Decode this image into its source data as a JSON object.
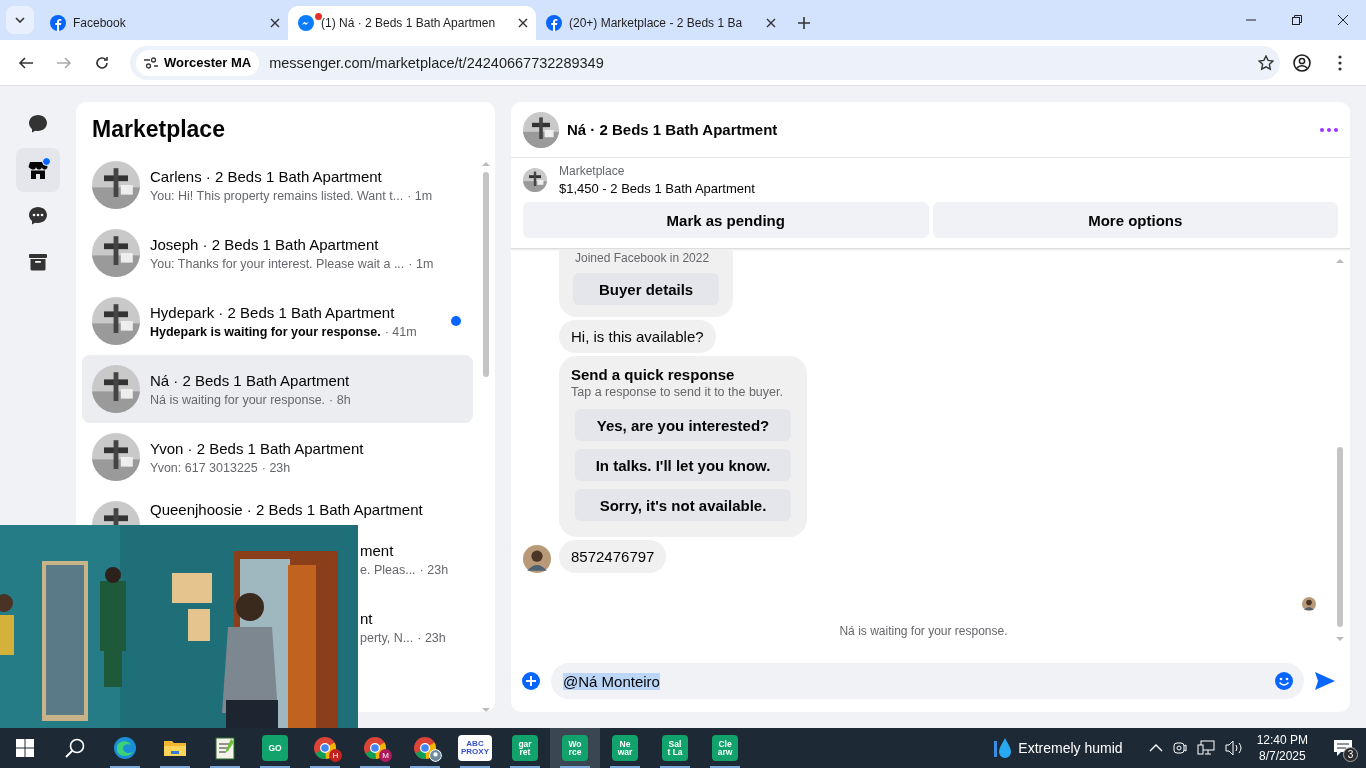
{
  "browser": {
    "tabs": [
      {
        "title": "Facebook",
        "kind": "facebook",
        "selected": false,
        "notification": false
      },
      {
        "title": "(1) Ná · 2 Beds 1 Bath Apartmen",
        "kind": "messenger",
        "selected": true,
        "notification": true
      },
      {
        "title": "(20+) Marketplace - 2 Beds 1 Ba",
        "kind": "facebook",
        "selected": false,
        "notification": false
      }
    ],
    "site_chip": "Worcester MA",
    "url": "messenger.com/marketplace/t/24240667732289349"
  },
  "nav": [
    {
      "kind": "chats",
      "selected": false,
      "unread": false
    },
    {
      "kind": "marketplace",
      "selected": true,
      "unread": true
    },
    {
      "kind": "requests",
      "selected": false,
      "unread": false
    },
    {
      "kind": "archive",
      "selected": false,
      "unread": false
    }
  ],
  "list": {
    "title": "Marketplace",
    "rows": [
      {
        "kind": "full",
        "title": "Carlens · 2 Beds 1 Bath Apartment",
        "preview": "You: Hi! This property remains listed. Want t...",
        "time": "· 1m",
        "unread": false,
        "selected": false
      },
      {
        "kind": "full",
        "title": "Joseph · 2 Beds 1 Bath Apartment",
        "preview": "You: Thanks for your interest. Please wait a ...",
        "time": "· 1m",
        "unread": false,
        "selected": false
      },
      {
        "kind": "full",
        "title": "Hydepark · 2 Beds 1 Bath Apartment",
        "preview": "Hydepark is waiting for your response.",
        "time": "· 41m",
        "unread": true,
        "selected": false
      },
      {
        "kind": "full",
        "title": "Ná · 2 Beds 1 Bath Apartment",
        "preview": "Ná is waiting for your response.",
        "time": "· 8h",
        "unread": false,
        "selected": true
      },
      {
        "kind": "full",
        "title": "Yvon · 2 Beds 1 Bath Apartment",
        "preview": "Yvon: 617 3013225",
        "time": "· 23h",
        "unread": false,
        "selected": false
      },
      {
        "kind": "top_cut",
        "title": "Queenjhoosie · 2 Beds 1 Bath Apartment",
        "unread": false,
        "selected": false
      },
      {
        "kind": "partial",
        "title": "ment",
        "preview": "e. Pleas...",
        "time": "· 23h",
        "unread": false,
        "selected": false
      },
      {
        "kind": "partial",
        "title": "nt",
        "preview": "perty, N...",
        "time": "· 23h",
        "unread": false,
        "selected": false
      }
    ]
  },
  "chat": {
    "title": "Ná · 2 Beds 1 Bath Apartment",
    "listing": {
      "label": "Marketplace",
      "title": "$1,450 - 2 Beds 1 Bath Apartment"
    },
    "actions": [
      "Mark as pending",
      "More options"
    ],
    "messages": [
      {
        "kind": "buyer_card",
        "caption": "Joined Facebook in 2022",
        "button": "Buyer details"
      },
      {
        "kind": "text",
        "text": "Hi, is this available?",
        "avatar": false
      },
      {
        "kind": "quick",
        "title": "Send a quick response",
        "subtitle": "Tap a response to send it to the buyer.",
        "options": [
          "Yes, are you interested?",
          "In talks. I'll let you know.",
          "Sorry, it's not available."
        ]
      },
      {
        "kind": "text",
        "text": "8572476797",
        "avatar": true
      }
    ],
    "read_receipt": true,
    "status": "Ná is waiting for your response.",
    "composer": {
      "value": "@Ná Monteiro",
      "highlighted": true
    }
  },
  "taskbar": {
    "apps": [
      {
        "kind": "edge",
        "active": false
      },
      {
        "kind": "folder",
        "active": false
      },
      {
        "kind": "notepad",
        "active": false
      },
      {
        "kind": "tile",
        "lines": [
          "GO"
        ],
        "active": false
      },
      {
        "kind": "chrome",
        "badge": "H",
        "color": "#c5221f",
        "active": false
      },
      {
        "kind": "chrome",
        "badge": "M",
        "color": "#b0195c",
        "active": false
      },
      {
        "kind": "chrome",
        "active": false
      },
      {
        "kind": "white_tile",
        "lines": [
          "ABC",
          "PROXY"
        ],
        "active": false
      },
      {
        "kind": "tile",
        "lines": [
          "gar",
          "ret"
        ],
        "active": false
      },
      {
        "kind": "tile",
        "lines": [
          "Wo",
          "rce"
        ],
        "active": true
      },
      {
        "kind": "tile",
        "lines": [
          "Ne",
          "war"
        ],
        "active": false
      },
      {
        "kind": "tile",
        "lines": [
          "Sal",
          "t La"
        ],
        "active": false
      },
      {
        "kind": "tile",
        "lines": [
          "Cle",
          "arw"
        ],
        "active": false
      }
    ],
    "weather": "Extremely humid",
    "time": "12:40 PM",
    "date": "8/7/2025",
    "notifications": "3"
  }
}
